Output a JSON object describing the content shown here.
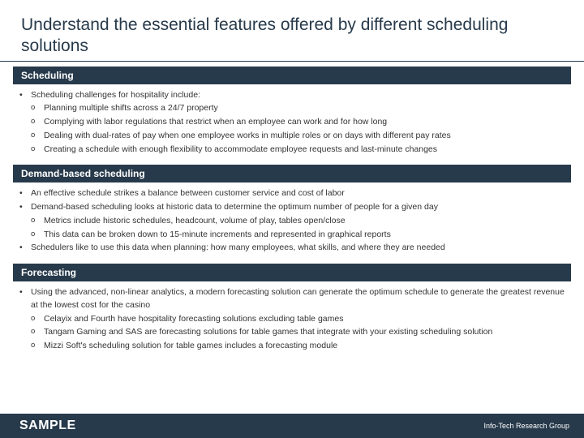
{
  "title": "Understand the essential features offered by different scheduling solutions",
  "sections": [
    {
      "header": "Scheduling",
      "items": [
        {
          "text": "Scheduling challenges for hospitality include:",
          "sub": [
            "Planning multiple shifts across a 24/7 property",
            "Complying with labor regulations that restrict when an employee can work and for how long",
            "Dealing with dual-rates of pay when one employee works in multiple roles or on days with different pay rates",
            "Creating a schedule with enough flexibility to accommodate employee requests and last-minute changes"
          ]
        }
      ]
    },
    {
      "header": "Demand-based scheduling",
      "items": [
        {
          "text": "An effective schedule strikes a balance between customer service and cost of labor",
          "sub": []
        },
        {
          "text": "Demand-based scheduling looks at historic data to determine the optimum number of people for a given day",
          "sub": [
            "Metrics include historic schedules, headcount, volume of play, tables open/close",
            "This data can be broken down to 15-minute increments and represented in graphical reports"
          ]
        },
        {
          "text": "Schedulers like to use this data when planning: how many employees, what skills, and where they are needed",
          "sub": []
        }
      ]
    },
    {
      "header": "Forecasting",
      "items": [
        {
          "text": "Using the advanced, non-linear analytics, a modern forecasting solution can generate the optimum schedule to generate the greatest revenue at the lowest cost for the casino",
          "sub": [
            "Celayix and Fourth have hospitality forecasting solutions excluding table games",
            "Tangam Gaming and SAS are forecasting solutions for table games that integrate with your existing scheduling solution",
            "Mizzi Soft's scheduling solution for table games includes a forecasting module"
          ]
        }
      ]
    }
  ],
  "footer": {
    "left": "SAMPLE",
    "right": "Info-Tech Research Group"
  }
}
